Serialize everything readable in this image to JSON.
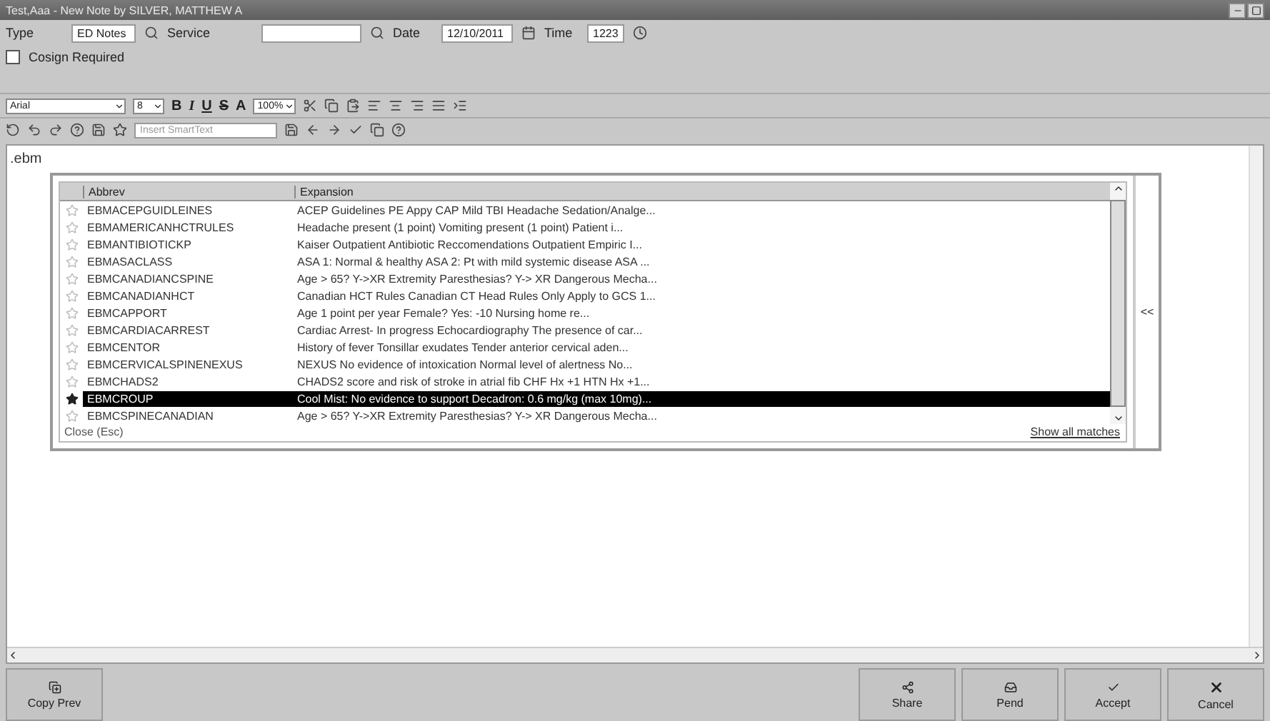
{
  "window": {
    "title": "Test,Aaa - New Note by SILVER, MATTHEW A"
  },
  "header": {
    "type_label": "Type",
    "type_value": "ED Notes",
    "service_label": "Service",
    "date_label": "Date",
    "date_value": "12/10/2011",
    "time_label": "Time",
    "time_value": "1223",
    "cosign": {
      "label": "Cosign Required",
      "checked": false
    }
  },
  "format_toolbar": {
    "font": "Arial",
    "size": "8",
    "bold": "B",
    "italic": "I",
    "underline": "U",
    "strike": "S",
    "font_color": "A",
    "zoom": "100%"
  },
  "smarttext_toolbar": {
    "placeholder": "Insert SmartText"
  },
  "editor": {
    "text": ".ebm"
  },
  "autotext_popup": {
    "columns": [
      "Abbrev",
      "Expansion"
    ],
    "rows": [
      {
        "abbrev": "EBMACEPGUIDLEINES",
        "expansion": "ACEP Guidelines PE Appy CAP Mild TBI Headache Sedation/Analge...",
        "starred": false,
        "selected": false
      },
      {
        "abbrev": "EBMAMERICANHCTRULES",
        "expansion": "Headache present (1 point)  Vomiting present (1 point)  Patient i...",
        "starred": false,
        "selected": false
      },
      {
        "abbrev": "EBMANTIBIOTICKP",
        "expansion": "Kaiser Outpatient Antibiotic Reccomendations Outpatient Empiric I...",
        "starred": false,
        "selected": false
      },
      {
        "abbrev": "EBMASACLASS",
        "expansion": "ASA 1: Normal & healthy ASA 2: Pt with mild systemic disease ASA ...",
        "starred": false,
        "selected": false
      },
      {
        "abbrev": "EBMCANADIANCSPINE",
        "expansion": "Age > 65? Y->XR Extremity Paresthesias? Y-> XR Dangerous Mecha...",
        "starred": false,
        "selected": false
      },
      {
        "abbrev": "EBMCANADIANHCT",
        "expansion": "Canadian HCT Rules  Canadian CT Head Rules Only Apply to GCS 1...",
        "starred": false,
        "selected": false
      },
      {
        "abbrev": "EBMCAPPORT",
        "expansion": "Age 1 point per year Female? Yes: -10 Nursing home re...",
        "starred": false,
        "selected": false
      },
      {
        "abbrev": "EBMCARDIACARREST",
        "expansion": "Cardiac Arrest- In progress  Echocardiography The presence of car...",
        "starred": false,
        "selected": false
      },
      {
        "abbrev": "EBMCENTOR",
        "expansion": "History of fever Tonsillar exudates Tender anterior cervical aden...",
        "starred": false,
        "selected": false
      },
      {
        "abbrev": "EBMCERVICALSPINENEXUS",
        "expansion": "NEXUS  No evidence of intoxication Normal level of alertness No...",
        "starred": false,
        "selected": false
      },
      {
        "abbrev": "EBMCHADS2",
        "expansion": "CHADS2 score and risk of stroke in atrial fib CHF Hx +1 HTN Hx +1...",
        "starred": false,
        "selected": false
      },
      {
        "abbrev": "EBMCROUP",
        "expansion": "Cool Mist: No evidence to support  Decadron: 0.6 mg/kg (max 10mg)...",
        "starred": true,
        "selected": true
      },
      {
        "abbrev": "EBMCSPINECANADIAN",
        "expansion": "Age > 65? Y->XR Extremity Paresthesias? Y-> XR Dangerous Mecha...",
        "starred": false,
        "selected": false
      }
    ],
    "close": "Close (Esc)",
    "show_all": "Show all matches",
    "collapse": "<<"
  },
  "buttons": [
    {
      "label": "Copy Prev",
      "kind": "copy"
    },
    {
      "kind": "spacer"
    },
    {
      "label": "Share",
      "kind": "share"
    },
    {
      "label": "Pend",
      "kind": "pend"
    },
    {
      "label": "Accept",
      "kind": "accept"
    },
    {
      "label": "Cancel",
      "kind": "cancel"
    }
  ]
}
